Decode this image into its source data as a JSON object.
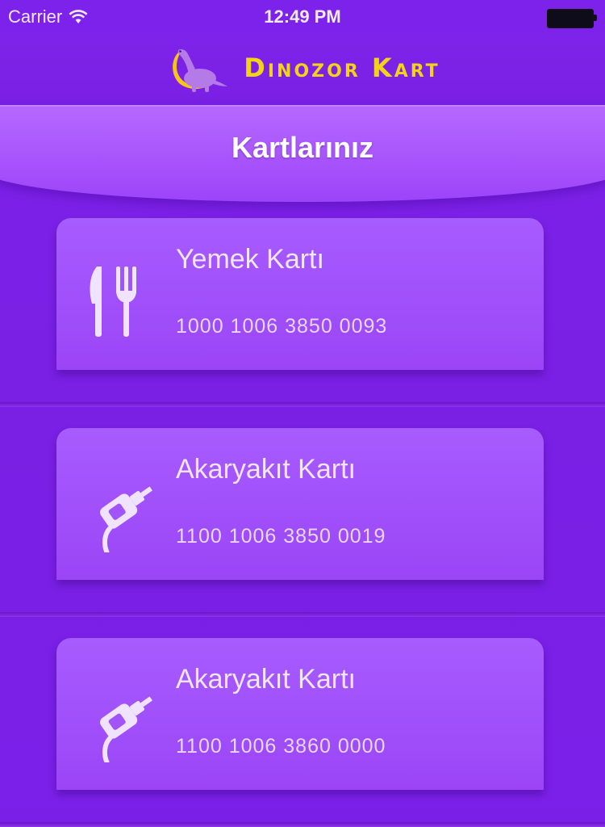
{
  "status_bar": {
    "carrier": "Carrier",
    "time": "12:49 PM"
  },
  "header": {
    "title": "Dinozor Kart"
  },
  "section": {
    "title": "Kartlarınız"
  },
  "cards": [
    {
      "name": "Yemek Kartı",
      "number": "1000 1006 3850 0093",
      "icon": "fork-knife-icon"
    },
    {
      "name": "Akaryakıt Kartı",
      "number": "1100 1006 3850 0019",
      "icon": "fuel-nozzle-icon"
    },
    {
      "name": "Akaryakıt Kartı",
      "number": "1100 1006 3860 0000",
      "icon": "fuel-nozzle-icon"
    }
  ],
  "colors": {
    "background": "#7a1fe6",
    "brand_title": "#f5d21a",
    "card": "#a75cff"
  }
}
